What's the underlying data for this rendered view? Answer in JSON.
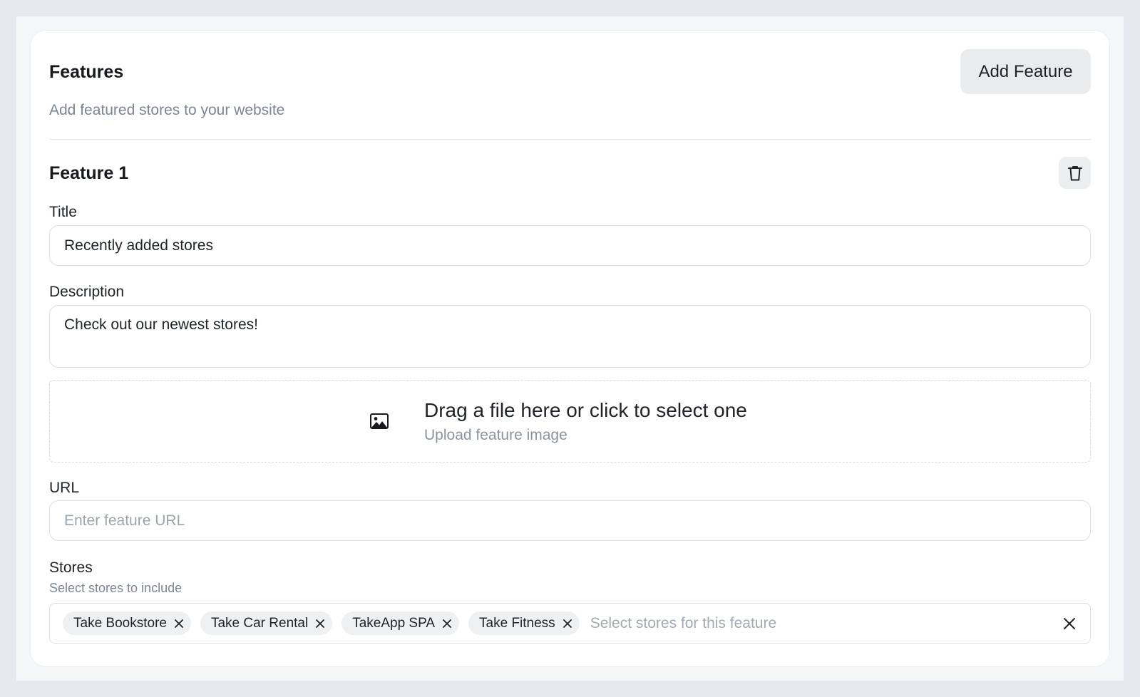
{
  "header": {
    "title": "Features",
    "subtitle": "Add featured stores to your website",
    "add_button": "Add Feature"
  },
  "feature": {
    "title": "Feature 1",
    "title_label": "Title",
    "title_value": "Recently added stores",
    "description_label": "Description",
    "description_value": "Check out our newest stores!",
    "upload": {
      "main": "Drag a file here or click to select one",
      "sub": "Upload feature image",
      "icon": "image-icon"
    },
    "url_label": "URL",
    "url_placeholder": "Enter feature URL",
    "url_value": "",
    "stores_label": "Stores",
    "stores_hint": "Select stores to include",
    "stores_placeholder": "Select stores for this feature",
    "selected_stores": [
      {
        "label": "Take Bookstore"
      },
      {
        "label": "Take Car Rental"
      },
      {
        "label": "TakeApp SPA"
      },
      {
        "label": "Take Fitness"
      }
    ]
  },
  "icons": {
    "delete": "trash-icon",
    "remove_chip": "close-icon",
    "clear_all": "close-icon"
  }
}
